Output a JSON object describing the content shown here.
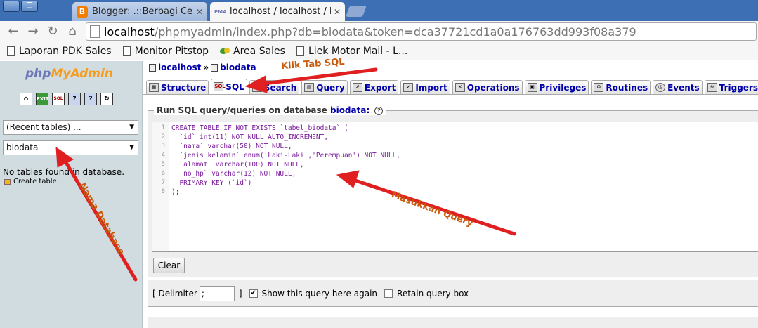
{
  "browser": {
    "tabs": [
      {
        "title": "Blogger: .::Berbagi Ceri",
        "active": false
      },
      {
        "title": "localhost / localhost / bi",
        "active": true
      }
    ],
    "url_host": "localhost",
    "url_path": "/phpmyadmin/index.php?db=biodata&token=dca37721cd1a0a176763dd993f08a379",
    "bookmarks": [
      "Laporan PDK Sales",
      "Monitor Pitstop",
      "Area Sales",
      "Liek Motor Mail - L..."
    ]
  },
  "sidebar": {
    "logo_php": "php",
    "logo_my": "My",
    "logo_admin": "Admin",
    "recent_tables": "(Recent tables) ...",
    "database": "biodata",
    "no_tables": "No tables found in database.",
    "create_table": "Create table"
  },
  "breadcrumb": {
    "server": "localhost",
    "sep": "»",
    "db": "biodata"
  },
  "tabs": [
    "Structure",
    "SQL",
    "Search",
    "Query",
    "Export",
    "Import",
    "Operations",
    "Privileges",
    "Routines",
    "Events",
    "Triggers"
  ],
  "query": {
    "legend": "Run SQL query/queries on database",
    "legend_db": "biodata:",
    "lines": [
      "CREATE TABLE IF NOT EXISTS `tabel_biodata` (",
      "  `id` int(11) NOT NULL AUTO_INCREMENT,",
      "  `nama` varchar(50) NOT NULL,",
      "  `jenis_kelamin` enum('Laki-Laki','Perempuan') NOT NULL,",
      "  `alamat` varchar(100) NOT NULL,",
      "  `no_hp` varchar(12) NOT NULL,",
      "  PRIMARY KEY (`id`)",
      ");"
    ],
    "line_numbers": [
      "1",
      "2",
      "3",
      "4",
      "5",
      "6",
      "7",
      "8"
    ],
    "clear_label": "Clear"
  },
  "options": {
    "delimiter_label": "[ Delimiter",
    "delimiter_value": ";",
    "delimiter_close": "]",
    "show_query_label": "Show this query here again",
    "show_query_checked": true,
    "retain_label": "Retain query box",
    "retain_checked": false
  },
  "annotations": {
    "klik_tab": "Klik Tab SQL",
    "masukkan": "Masukkan Query",
    "nama_db": "Nama Database"
  },
  "colors": {
    "annotation": "#c85a0c",
    "arrow": "#e02020",
    "link": "#0000aa"
  }
}
